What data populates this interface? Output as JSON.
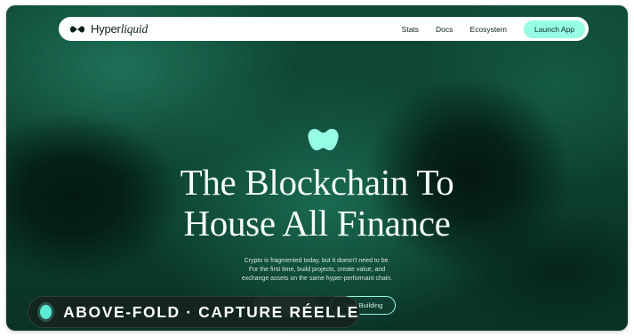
{
  "nav": {
    "brand_plain": "Hyper",
    "brand_italic": "liquid",
    "links": [
      "Stats",
      "Docs",
      "Ecosystem"
    ],
    "cta": "Launch App",
    "cta_color": "#97fce4"
  },
  "hero": {
    "icon": "liquid-blob-icon",
    "headline_line1": "The Blockchain To",
    "headline_line2": "House All Finance",
    "subtext": [
      "Crypto is fragmented today, but it doesn't need to be.",
      "For the first time, build projects, create value, and",
      "exchange assets on the same hyper-performant chain."
    ],
    "secondary_button": "",
    "primary_button": "Start Building"
  },
  "overlay": {
    "label": "ABOVE-FOLD · CAPTURE RÉELLE",
    "dot_color": "#5eead4"
  },
  "colors": {
    "background": "#0c3d2e",
    "accent": "#97fce4"
  }
}
